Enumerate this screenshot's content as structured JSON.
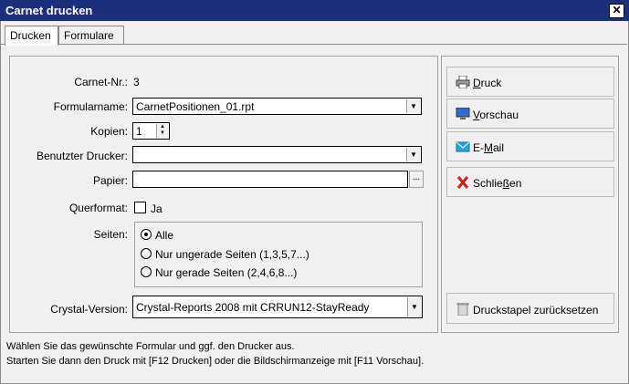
{
  "window": {
    "title": "Carnet drucken",
    "close_icon": "close-icon"
  },
  "tabs": [
    {
      "label": "Drucken",
      "active": true
    },
    {
      "label": "Formulare",
      "active": false
    }
  ],
  "form": {
    "carnet_nr_label": "Carnet-Nr.:",
    "carnet_nr_value": "3",
    "formularname_label": "Formularname:",
    "formularname_value": "CarnetPositionen_01.rpt",
    "kopien_label": "Kopien:",
    "kopien_value": "1",
    "drucker_label": "Benutzter Drucker:",
    "drucker_value": "",
    "papier_label": "Papier:",
    "papier_value": "",
    "papier_browse": "...",
    "querformat_label": "Querformat:",
    "querformat_checkbox_label": "Ja",
    "querformat_checked": false,
    "seiten_label": "Seiten:",
    "seiten_options": [
      {
        "label": "Alle",
        "selected": true
      },
      {
        "label": "Nur ungerade Seiten (1,3,5,7...)",
        "selected": false
      },
      {
        "label": "Nur gerade Seiten (2,4,6,8...)",
        "selected": false
      }
    ],
    "crystal_label": "Crystal-Version:",
    "crystal_value": "Crystal-Reports 2008 mit CRRUN12-StayReady"
  },
  "buttons": {
    "druck_first": "D",
    "druck_rest": "ruck",
    "vorschau_first": "V",
    "vorschau_rest": "orschau",
    "email_pre": "E-",
    "email_ul": "M",
    "email_post": "ail",
    "schliessen_pre": "Schlie",
    "schliessen_ul": "ß",
    "schliessen_post": "en",
    "reset": "Druckstapel zurücksetzen"
  },
  "status": {
    "line1": "Wählen Sie das gewünschte Formular und ggf. den Drucker aus.",
    "line2": "Starten Sie dann den Druck mit [F12 Drucken] oder die Bildschirmanzeige mit [F11 Vorschau]."
  },
  "colors": {
    "titlebar": "#1c2f7c",
    "email_icon": "#20a8d8",
    "close_red": "#d02020"
  }
}
